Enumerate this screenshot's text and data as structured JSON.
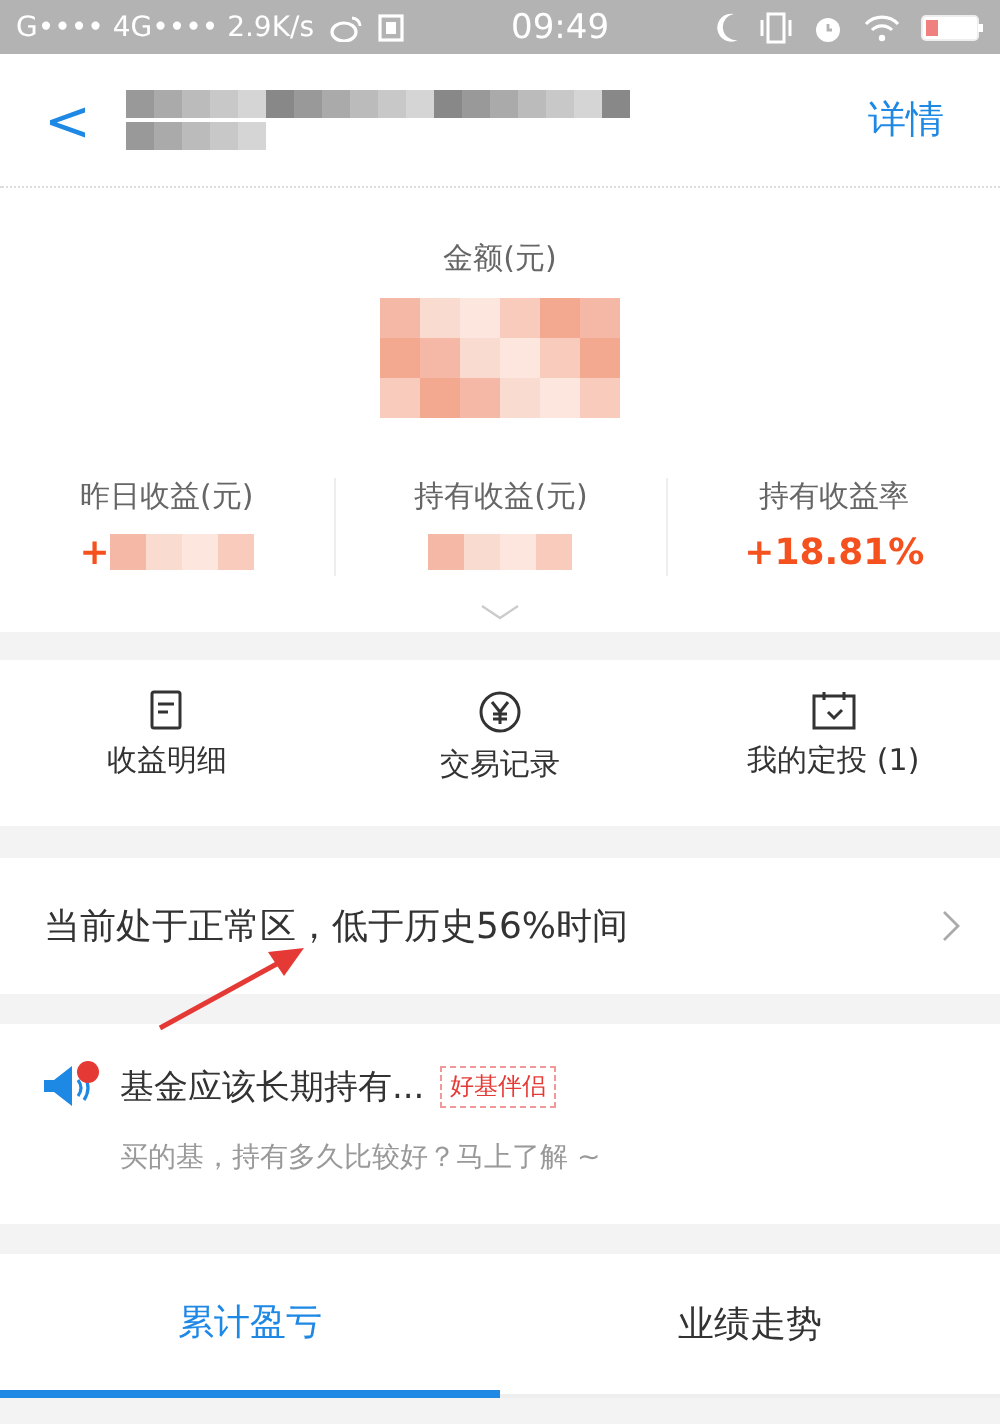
{
  "status_bar": {
    "left": "G•••• 4G•••• 2.9K/s",
    "time": "09:49"
  },
  "nav": {
    "back": "<",
    "action": "详情"
  },
  "amount": {
    "label": "金额(元)"
  },
  "stats": [
    {
      "label": "昨日收益(元)",
      "value": "+"
    },
    {
      "label": "持有收益(元)"
    },
    {
      "label": "持有收益率",
      "value": "+18.81%"
    }
  ],
  "shortcuts": [
    {
      "kind": "document",
      "label": "收益明细"
    },
    {
      "kind": "yuan",
      "label": "交易记录"
    },
    {
      "kind": "calendar",
      "label": "我的定投 (1)"
    }
  ],
  "valuation": {
    "text": "当前处于正常区，低于历史56%时间"
  },
  "notice": {
    "title": "基金应该长期持有...",
    "tag": "好基伴侣",
    "subtitle": "买的基，持有多久比较好？马上了解 ~",
    "unread": true
  },
  "tabs": [
    {
      "label": "累计盈亏",
      "selected": true
    },
    {
      "label": "业绩走势",
      "selected": false
    }
  ]
}
